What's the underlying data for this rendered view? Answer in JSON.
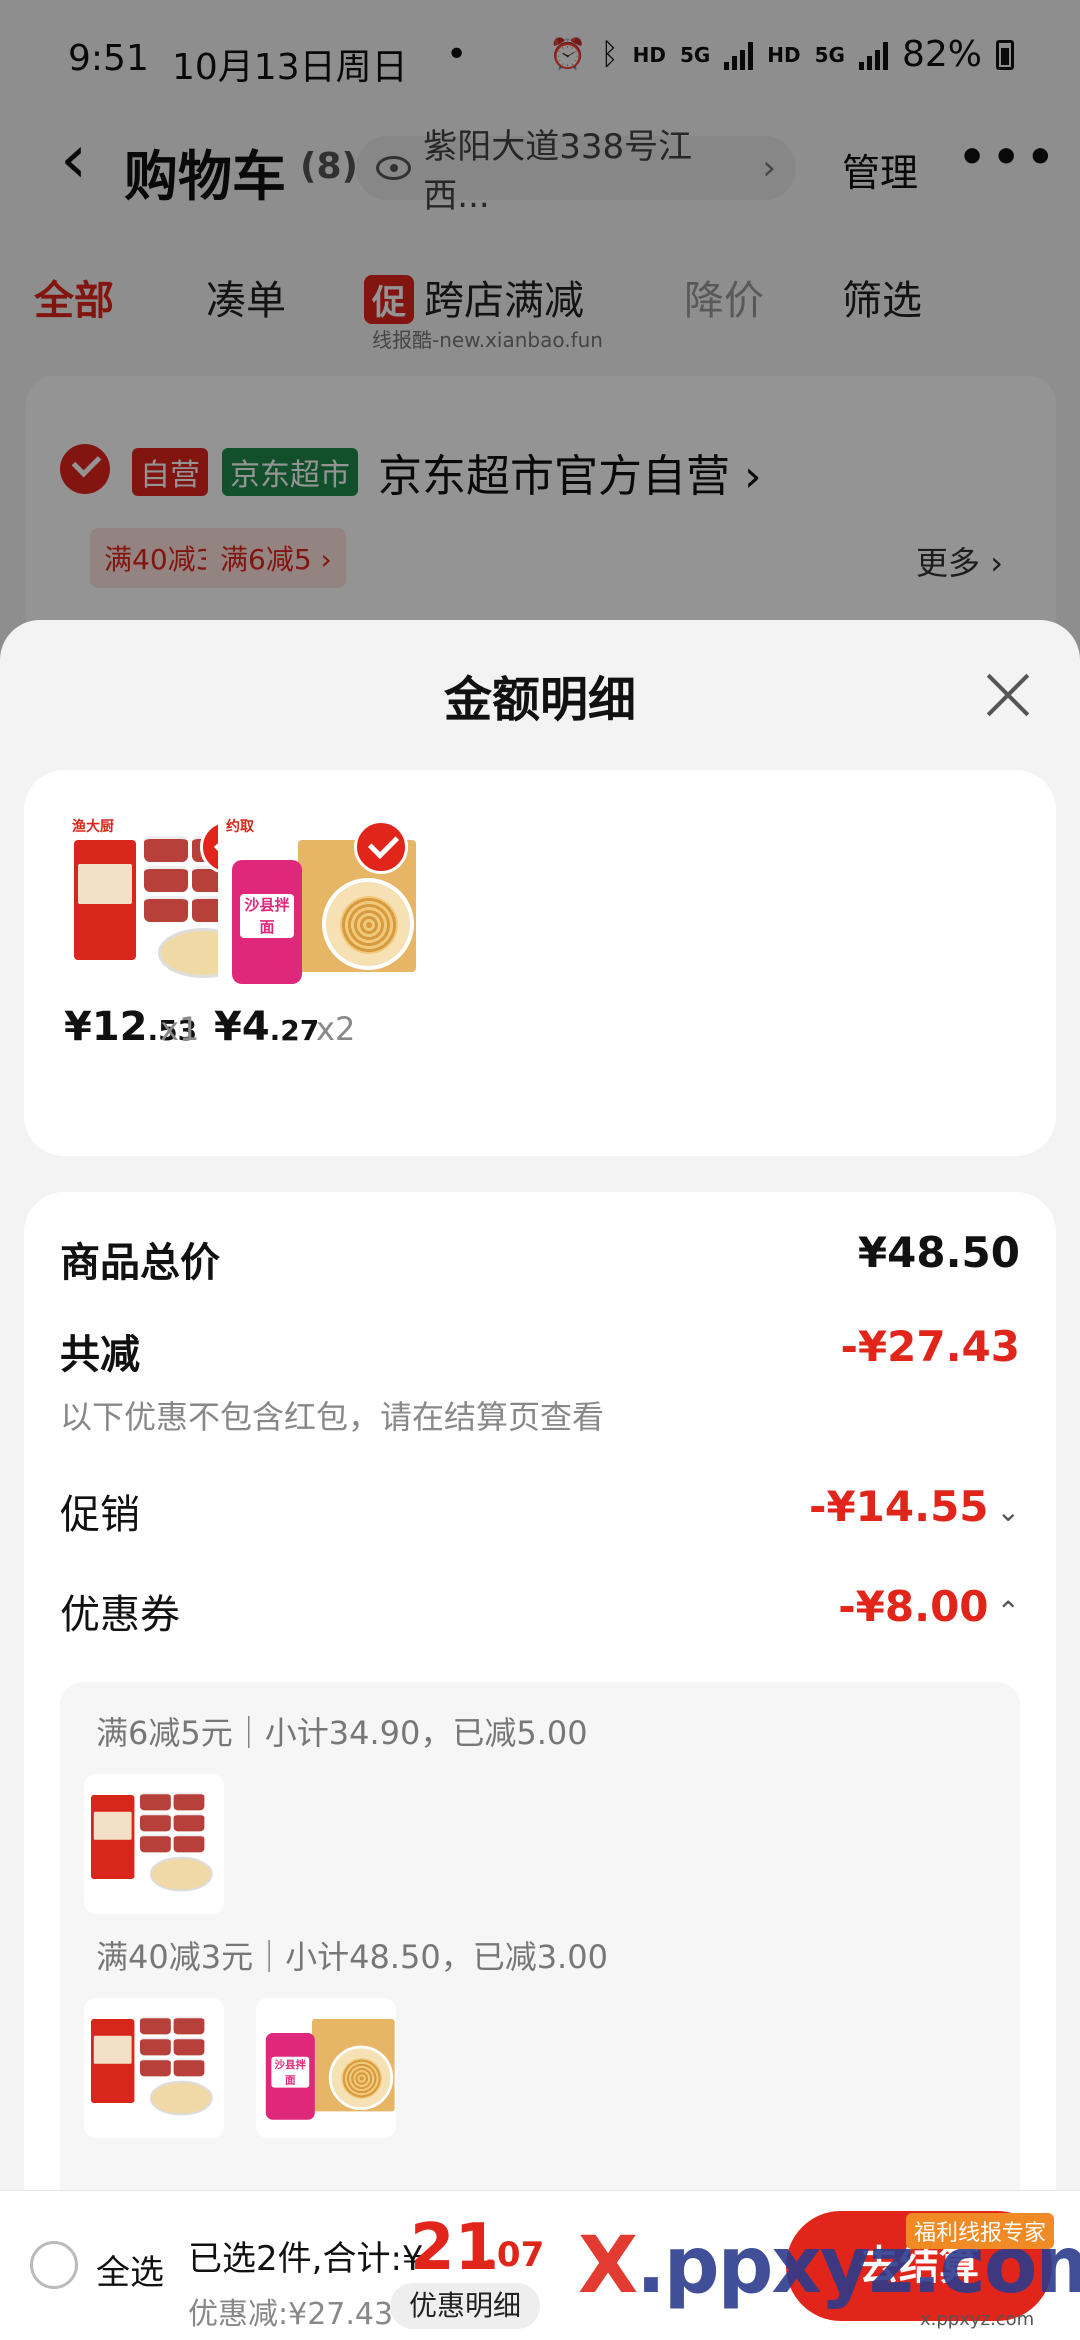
{
  "status_bar": {
    "time": "9:51",
    "date": "10月13日周日",
    "dot": "•",
    "hd1": "HD",
    "g1": "5G",
    "hd2": "HD",
    "g2": "5G",
    "battery": "82%"
  },
  "nav": {
    "title": "购物车",
    "count": "(8)",
    "address": "紫阳大道338号江西...",
    "manage": "管理",
    "more": "•••"
  },
  "filter_tabs": {
    "all": "全部",
    "combine": "凑单",
    "promo_badge": "促",
    "cross_store": "跨店满减",
    "price_drop": "降价",
    "filter": "筛选"
  },
  "watermark_top": "线报酷-new.xianbao.fun",
  "store": {
    "tag_self": "自营",
    "tag_market": "京东超市",
    "name": "京东超市官方自营",
    "coupon1": "满40减3",
    "coupon2": "满6减5",
    "more": "更多"
  },
  "sheet": {
    "title": "金额明细",
    "products": [
      {
        "price_int": "¥12",
        "price_dec": ".53",
        "qty": "x1",
        "brand": "渔大厨"
      },
      {
        "price_int": "¥4",
        "price_dec": ".27",
        "qty": "x2",
        "brand": "约取",
        "pack_label": "沙县拌面"
      }
    ],
    "summary": {
      "total_label": "商品总价",
      "total_value": "¥48.50",
      "discount_label": "共减",
      "discount_value": "-¥27.43",
      "discount_note": "以下优惠不包含红包，请在结算页查看",
      "promo_label": "促销",
      "promo_value": "-¥14.55",
      "coupon_label": "优惠券",
      "coupon_value": "-¥8.00",
      "coupon_lines": [
        "满6减5元｜小计34.90，已减5.00",
        "满40减3元｜小计48.50，已减3.00"
      ]
    }
  },
  "bottom": {
    "select_all": "全选",
    "selected": "已选2件,合计:¥",
    "total_int": "21",
    "total_dec": ".07",
    "discount": "优惠减:¥27.43",
    "detail_btn": "优惠明细",
    "checkout": "去结算"
  },
  "watermark_bottom": {
    "logo_x": "X",
    "logo_rest": ".ppxyz.com",
    "badge": "福利线报专家",
    "url": "x.ppxyz.com"
  }
}
